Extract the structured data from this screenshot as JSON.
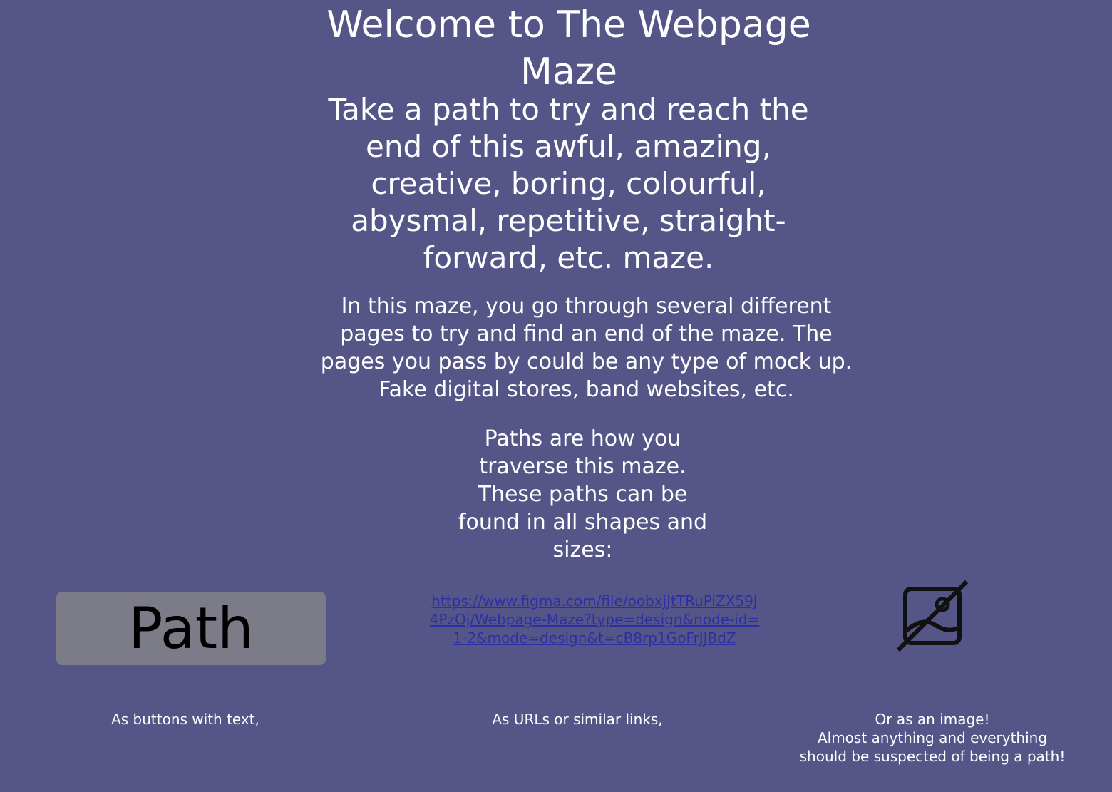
{
  "header": {
    "title": "Welcome to The Webpage Maze",
    "subtitle": "Take a path to try and reach the end of this awful, amazing, creative, boring, colourful, abysmal, repetitive, straight-forward, etc. maze."
  },
  "intro": {
    "description": "In this maze, you go through several different pages to try and find an end of the maze. The pages you pass by could be any type of mock up. Fake digital stores, band websites, etc.",
    "paths_explanation": "Paths are how you traverse this maze. These paths can be found in all shapes and sizes:"
  },
  "examples": {
    "button": {
      "label": "Path",
      "caption": "As buttons with text,"
    },
    "link": {
      "text": "https://www.figma.com/file/oobxjJtTRuPiZX59J4PzOj/Webpage-Maze?type=design&node-id=1-2&mode=design&t=cB8rp1GoFrJJBdZ",
      "caption": "As URLs or similar links,"
    },
    "image": {
      "icon": "image-off-icon",
      "caption_line1": "Or as an image!",
      "caption_line2": "Almost anything and everything",
      "caption_line3": "should be suspected of being a path!"
    }
  },
  "colors": {
    "background": "#565587",
    "button_bg": "#7c7b88",
    "link": "#2b2fa6",
    "text": "#ffffff"
  }
}
